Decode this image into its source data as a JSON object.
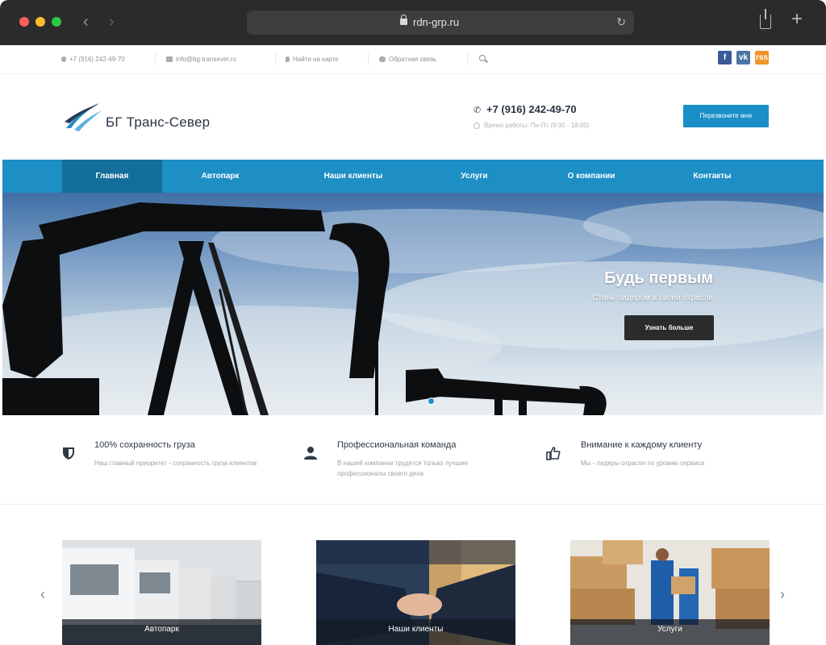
{
  "browser": {
    "url": "rdn-grp.ru"
  },
  "topbar": {
    "phone": "+7 (916) 242-49-70",
    "email": "info@bg-transever.ru",
    "map_link": "Найти на карте",
    "feedback_link": "Обратная связь",
    "social": [
      "f",
      "vk",
      "rss"
    ]
  },
  "header": {
    "logo_text": "БГ Транс-Север",
    "phone": "+7 (916) 242-49-70",
    "hours": "Время работы: Пн-Пт (9:00 - 18:00)",
    "callback_button": "Перезвоните мне"
  },
  "nav": {
    "items": [
      {
        "label": "Главная",
        "active": true
      },
      {
        "label": "Автопарк",
        "active": false
      },
      {
        "label": "Наши клиенты",
        "active": false
      },
      {
        "label": "Услуги",
        "active": false
      },
      {
        "label": "О компании",
        "active": false
      },
      {
        "label": "Контакты",
        "active": false
      }
    ]
  },
  "hero": {
    "title": "Будь первым",
    "subtitle": "Стань лидером в своей отрасли",
    "button": "Узнать больше"
  },
  "features": [
    {
      "icon": "shield-icon",
      "title": "100% сохранность груза",
      "text": "Наш главный приоритет - сохранность груза клиентов"
    },
    {
      "icon": "user-icon",
      "title": "Профессиональная команда",
      "text": "В нашей компании трудятся только лучшие профессионалы своего дела"
    },
    {
      "icon": "thumbs-up-icon",
      "title": "Внимание к каждому клиенту",
      "text": "Мы - лидеры отрасли по уровню сервиса"
    }
  ],
  "cards": [
    {
      "label": "Автопарк"
    },
    {
      "label": "Наши клиенты"
    },
    {
      "label": "Услуги"
    }
  ],
  "colors": {
    "brand_blue": "#1d8fc4",
    "nav_active": "#146e9a",
    "dark_button": "#2a2b2d"
  }
}
